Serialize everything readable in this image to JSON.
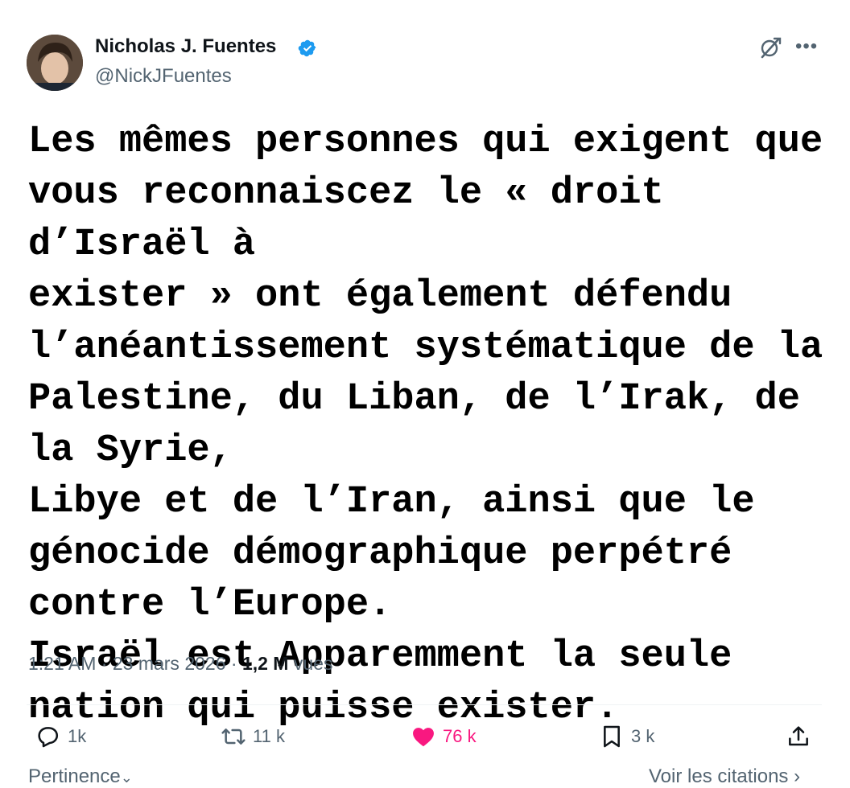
{
  "author": {
    "name": "Nicholas J. Fuentes",
    "handle": "@NickJFuentes",
    "verified": true,
    "avatar_icon": "avatar-photo"
  },
  "tweet": {
    "text": "Les mêmes personnes qui exigent que\nvous reconnaiscez le « droit d’Israël à\nexister » ont également défendu\nl’anéantissement systématique de la\nPalestine, du Liban, de l’Irak, de la Syrie,\nLibye et de l’Iran, ainsi que le\ngénocide démographique perpétré\ncontre l’Europe.\nIsraël est Apparemment la seule\nnation qui puisse exister."
  },
  "meta": {
    "time": "1:21 AM",
    "separator": "·",
    "date": "23 mars 2026",
    "views_count": "1,2 M",
    "views_label": "vues"
  },
  "actions": {
    "replies": "1k",
    "reposts": "11 k",
    "likes": "76 k",
    "bookmarks": "3 k"
  },
  "footer": {
    "sort_label": "Pertinence",
    "quotes_link": "Voir les citations"
  },
  "colors": {
    "like": "#f91880",
    "verified": "#1d9bf0",
    "secondary_text": "#536471"
  }
}
